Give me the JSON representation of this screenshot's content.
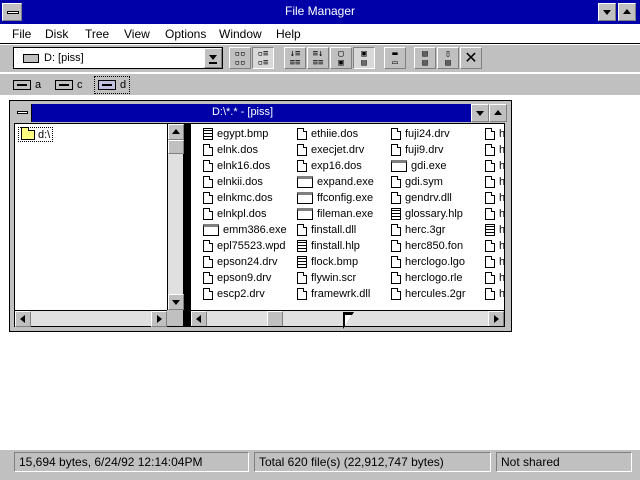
{
  "window": {
    "title": "File Manager"
  },
  "menu": [
    "File",
    "Disk",
    "Tree",
    "View",
    "Options",
    "Window",
    "Help"
  ],
  "toolbar": {
    "drive_value": "D: [piss]",
    "icons": [
      "view-name-icon",
      "view-details-icon",
      "sort-name-icon",
      "sort-type-icon",
      "new-window-icon",
      "network-drive-icon",
      "disconnect-icon",
      "copy-disk-icon",
      "paste-icon",
      "delete-icon"
    ]
  },
  "drives": [
    {
      "letter": "a",
      "icon": "floppy-drive-icon"
    },
    {
      "letter": "c",
      "icon": "hard-drive-icon"
    },
    {
      "letter": "d",
      "icon": "network-drive-icon",
      "selected": true
    }
  ],
  "child_window": {
    "title": "D:\\*.* - [piss]",
    "tree": {
      "root": "d:\\"
    },
    "files": [
      [
        {
          "name": "egypt.bmp",
          "icon": "lines"
        },
        {
          "name": "elnk.dos",
          "icon": "doc"
        },
        {
          "name": "elnk16.dos",
          "icon": "doc"
        },
        {
          "name": "elnkii.dos",
          "icon": "doc"
        },
        {
          "name": "elnkmc.dos",
          "icon": "doc"
        },
        {
          "name": "elnkpl.dos",
          "icon": "doc"
        },
        {
          "name": "emm386.exe",
          "icon": "exe"
        },
        {
          "name": "epl75523.wpd",
          "icon": "doc"
        },
        {
          "name": "epson24.drv",
          "icon": "doc"
        },
        {
          "name": "epson9.drv",
          "icon": "doc"
        },
        {
          "name": "escp2.drv",
          "icon": "doc"
        }
      ],
      [
        {
          "name": "ethiie.dos",
          "icon": "doc"
        },
        {
          "name": "execjet.drv",
          "icon": "doc"
        },
        {
          "name": "exp16.dos",
          "icon": "doc"
        },
        {
          "name": "expand.exe",
          "icon": "exe"
        },
        {
          "name": "ffconfig.exe",
          "icon": "exe"
        },
        {
          "name": "fileman.exe",
          "icon": "exe"
        },
        {
          "name": "finstall.dll",
          "icon": "doc"
        },
        {
          "name": "finstall.hlp",
          "icon": "lines"
        },
        {
          "name": "flock.bmp",
          "icon": "lines"
        },
        {
          "name": "flywin.scr",
          "icon": "doc"
        },
        {
          "name": "framewrk.dll",
          "icon": "doc"
        }
      ],
      [
        {
          "name": "fuji24.drv",
          "icon": "doc"
        },
        {
          "name": "fuji9.drv",
          "icon": "doc"
        },
        {
          "name": "gdi.exe",
          "icon": "exe"
        },
        {
          "name": "gdi.sym",
          "icon": "doc"
        },
        {
          "name": "gendrv.dll",
          "icon": "doc"
        },
        {
          "name": "glossary.hlp",
          "icon": "lines"
        },
        {
          "name": "herc.3gr",
          "icon": "doc"
        },
        {
          "name": "herc850.fon",
          "icon": "doc"
        },
        {
          "name": "herclogo.lgo",
          "icon": "doc"
        },
        {
          "name": "herclogo.rle",
          "icon": "doc"
        },
        {
          "name": "hercules.2gr",
          "icon": "doc"
        }
      ],
      [
        {
          "name": "he",
          "icon": "doc"
        },
        {
          "name": "he",
          "icon": "doc"
        },
        {
          "name": "he",
          "icon": "doc"
        },
        {
          "name": "he",
          "icon": "doc"
        },
        {
          "name": "hi",
          "icon": "doc"
        },
        {
          "name": "hn",
          "icon": "doc"
        },
        {
          "name": "ho",
          "icon": "lines"
        },
        {
          "name": "hp",
          "icon": "doc"
        },
        {
          "name": "hp",
          "icon": "doc"
        },
        {
          "name": "hp",
          "icon": "doc"
        },
        {
          "name": "hp",
          "icon": "doc"
        }
      ]
    ]
  },
  "status": {
    "selected": "15,694 bytes, 6/24/92 12:14:04PM",
    "total": "Total 620 file(s) (22,912,747 bytes)",
    "share": "Not shared"
  },
  "colors": {
    "title_bar": "#0000a8",
    "face": "#c0c0c0"
  }
}
